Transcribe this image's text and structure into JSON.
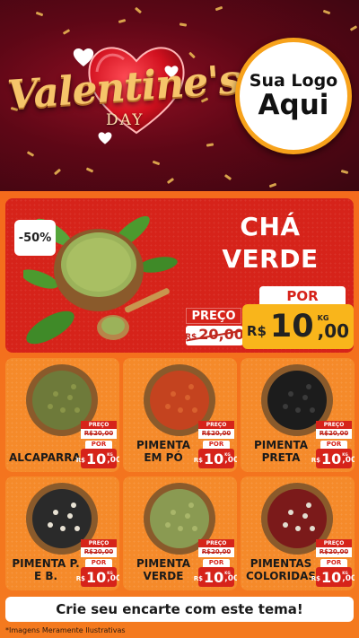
{
  "header": {
    "title": "Valentine's",
    "subtitle": "DAY",
    "logo_line1": "Sua Logo",
    "logo_line2": "Aqui"
  },
  "hero": {
    "discount": "-50%",
    "title": "CHÁ VERDE",
    "preco_label": "PREÇO",
    "old_currency": "R$",
    "old_value": "20,00",
    "por_label": "POR",
    "currency": "R$",
    "price_int": "10",
    "price_cents": ",00",
    "unit": "KG"
  },
  "products": [
    {
      "name": "ALCAPARRAS",
      "preco_label": "PREÇO",
      "old_price": "R$20,00",
      "por_label": "POR",
      "currency": "R$",
      "price_int": "10",
      "price_cents": ",00",
      "unit": "KG"
    },
    {
      "name": "PIMENTA EM PÓ",
      "preco_label": "PREÇO",
      "old_price": "R$20,00",
      "por_label": "POR",
      "currency": "R$",
      "price_int": "10",
      "price_cents": ",00",
      "unit": "KG"
    },
    {
      "name": "PIMENTA PRETA",
      "preco_label": "PREÇO",
      "old_price": "R$20,00",
      "por_label": "POR",
      "currency": "R$",
      "price_int": "10",
      "price_cents": ",00",
      "unit": "KG"
    },
    {
      "name": "PIMENTA P. E B.",
      "preco_label": "PREÇO",
      "old_price": "R$20,00",
      "por_label": "POR",
      "currency": "R$",
      "price_int": "10",
      "price_cents": ",00",
      "unit": "KG"
    },
    {
      "name": "PIMENTA VERDE",
      "preco_label": "PREÇO",
      "old_price": "R$20,00",
      "por_label": "POR",
      "currency": "R$",
      "price_int": "10",
      "price_cents": ",00",
      "unit": "KG"
    },
    {
      "name": "PIMENTAS COLORIDAS",
      "preco_label": "PREÇO",
      "old_price": "R$20,00",
      "por_label": "POR",
      "currency": "R$",
      "price_int": "10",
      "price_cents": ",00",
      "unit": "KG"
    }
  ],
  "cta": "Crie seu encarte com este tema!",
  "footnote": "*Imagens Meramente Ilustrativas",
  "colors": {
    "header_bg": "#5e0716",
    "body_bg": "#f26a1b",
    "hero_bg": "#d6231a",
    "price_yellow": "#f9b51b",
    "card_bg": "#f58a2a"
  }
}
